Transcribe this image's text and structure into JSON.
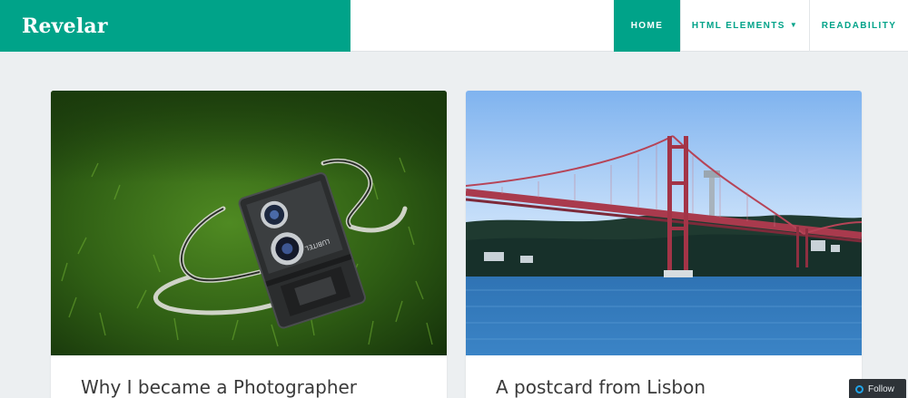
{
  "site": {
    "title": "Revelar"
  },
  "nav": {
    "items": [
      {
        "label": "HOME"
      },
      {
        "label": "HTML ELEMENTS"
      },
      {
        "label": "READABILITY"
      }
    ]
  },
  "posts": [
    {
      "title": "Why I became a Photographer",
      "image": "camera-on-grass-photo"
    },
    {
      "title": "A postcard from Lisbon",
      "image": "lisbon-bridge-photo"
    }
  ],
  "follow": {
    "label": "Follow"
  },
  "colors": {
    "accent": "#00a389",
    "background": "#eceff1",
    "follow_bg": "#2e3338"
  }
}
